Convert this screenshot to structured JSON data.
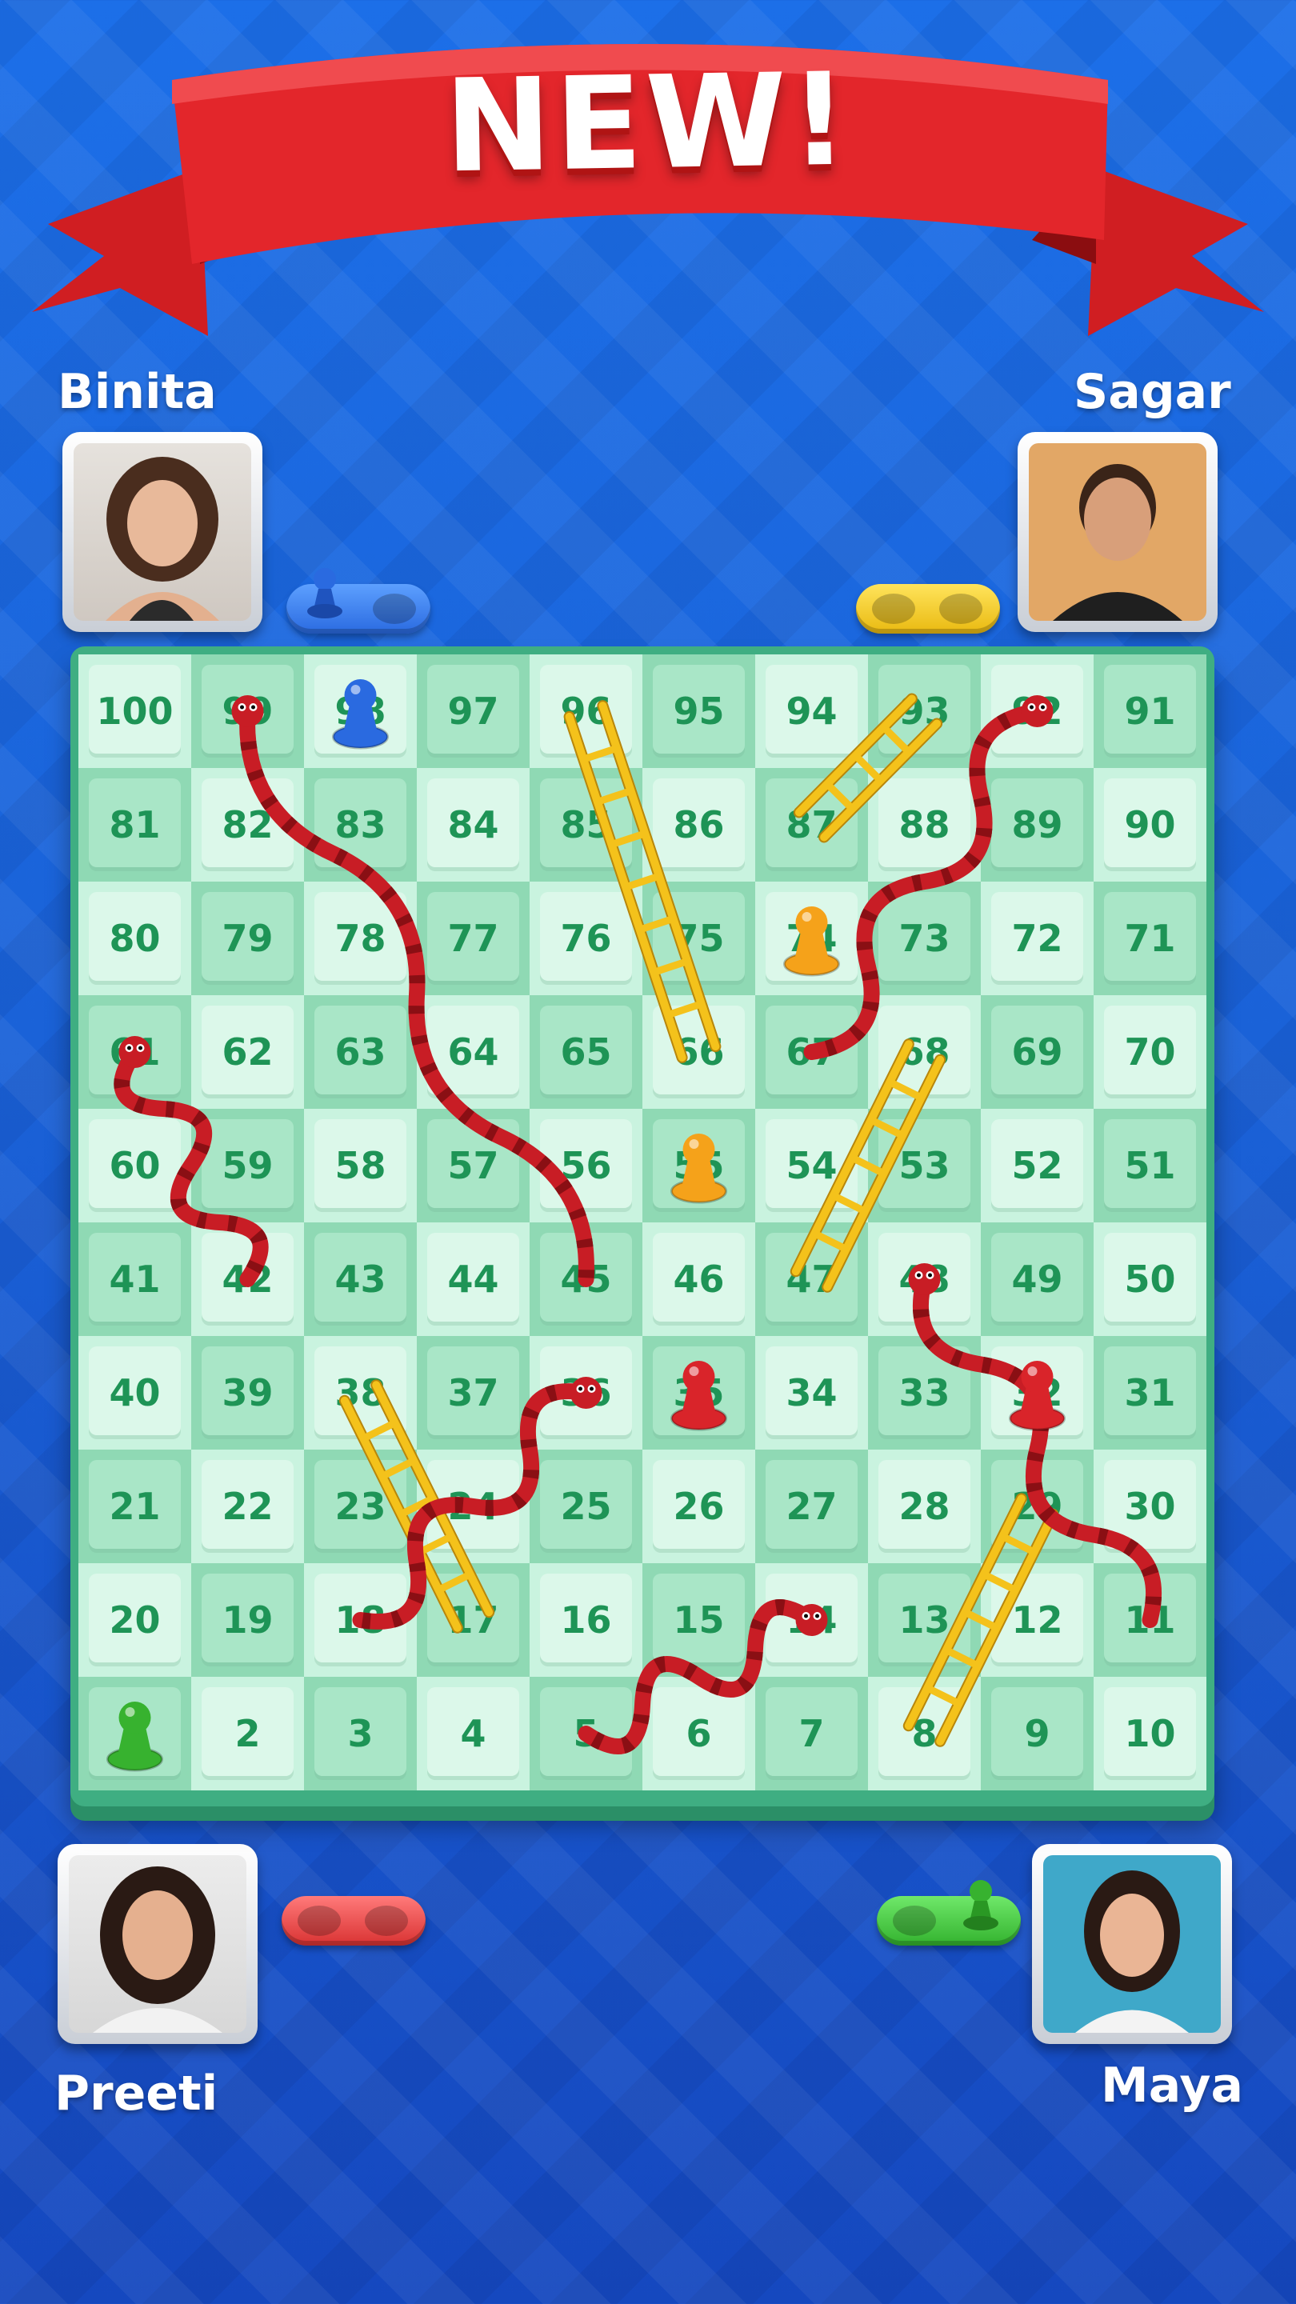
{
  "banner": {
    "title": "NEW!"
  },
  "players": [
    {
      "name": "Binita",
      "color": "#2a6ae0"
    },
    {
      "name": "Sagar",
      "color": "#f2cf1e"
    },
    {
      "name": "Preeti",
      "color": "#e03a3a"
    },
    {
      "name": "Maya",
      "color": "#3ec63a"
    }
  ],
  "board": {
    "rows": [
      [
        "100",
        "99",
        "98",
        "97",
        "96",
        "95",
        "94",
        "93",
        "92",
        "91"
      ],
      [
        "81",
        "82",
        "83",
        "84",
        "85",
        "86",
        "87",
        "88",
        "89",
        "90"
      ],
      [
        "80",
        "79",
        "78",
        "77",
        "76",
        "75",
        "74",
        "73",
        "72",
        "71"
      ],
      [
        "61",
        "62",
        "63",
        "64",
        "65",
        "66",
        "67",
        "68",
        "69",
        "70"
      ],
      [
        "60",
        "59",
        "58",
        "57",
        "56",
        "55",
        "54",
        "53",
        "52",
        "51"
      ],
      [
        "41",
        "42",
        "43",
        "44",
        "45",
        "46",
        "47",
        "48",
        "49",
        "50"
      ],
      [
        "40",
        "39",
        "38",
        "37",
        "36",
        "35",
        "34",
        "33",
        "32",
        "31"
      ],
      [
        "21",
        "22",
        "23",
        "24",
        "25",
        "26",
        "27",
        "28",
        "29",
        "30"
      ],
      [
        "20",
        "19",
        "18",
        "17",
        "16",
        "15",
        "14",
        "13",
        "12",
        "11"
      ],
      [
        "1",
        "2",
        "3",
        "4",
        "5",
        "6",
        "7",
        "8",
        "9",
        "10"
      ]
    ]
  },
  "pieces": [
    {
      "player": "blue",
      "color": "#2a6ae0",
      "square": 98
    },
    {
      "player": "orange",
      "color": "#f5a21a",
      "square": 74
    },
    {
      "player": "orange",
      "color": "#f5a21a",
      "square": 55
    },
    {
      "player": "red",
      "color": "#d9242a",
      "square": 35
    },
    {
      "player": "red",
      "color": "#d9242a",
      "square": 32
    },
    {
      "player": "green",
      "color": "#37b22f",
      "square": 1
    }
  ],
  "ladders": [
    {
      "from": 66,
      "to": 96
    },
    {
      "from": 87,
      "to": 93
    },
    {
      "from": 47,
      "to": 68
    },
    {
      "from": 17,
      "to": 38
    },
    {
      "from": 8,
      "to": 29
    }
  ],
  "snakes": [
    {
      "head": 99,
      "tail": 45
    },
    {
      "head": 92,
      "tail": 67
    },
    {
      "head": 61,
      "tail": 42
    },
    {
      "head": 36,
      "tail": 18
    },
    {
      "head": 14,
      "tail": 5
    },
    {
      "head": 48,
      "tail": 11
    }
  ],
  "colors": {
    "snake": "#c81d25",
    "snake_band": "#8a0f14",
    "ladder": "#f4c21b"
  }
}
